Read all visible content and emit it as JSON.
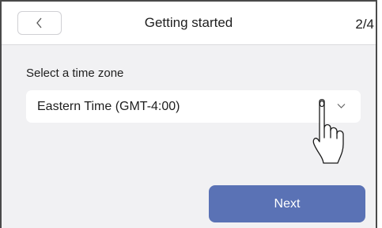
{
  "header": {
    "back_icon": "chevron-left-icon",
    "title": "Getting started",
    "step": "2/4"
  },
  "timezone": {
    "label": "Select a time zone",
    "selected_value": "Eastern Time (GMT-4:00)",
    "dropdown_icon": "chevron-down-icon"
  },
  "overlay": {
    "pointer_icon": "hand-pointer-icon"
  },
  "footer": {
    "next_label": "Next"
  },
  "colors": {
    "background": "#f1f1f3",
    "header_bg": "#ffffff",
    "primary_button": "#5a72b5",
    "text": "#1e1e1e"
  }
}
